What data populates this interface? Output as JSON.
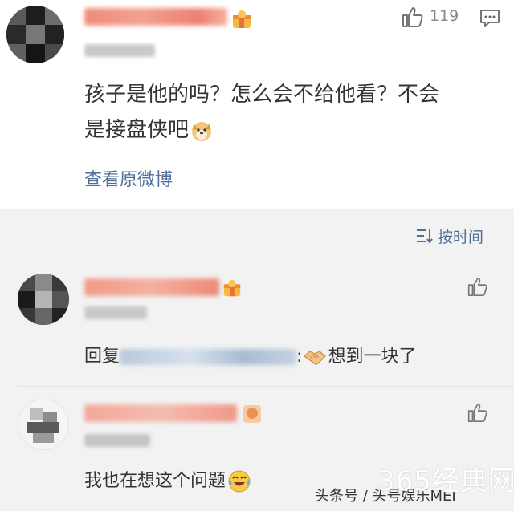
{
  "post": {
    "likes": "119",
    "text_line1": "孩子是他的吗？怎么会不给他看？不会",
    "text_line2": "是接盘侠吧",
    "view_original": "查看原微博"
  },
  "sort_label": "按时间",
  "replies": [
    {
      "prefix": "回复",
      "sep": ":",
      "text": "想到一块了"
    },
    {
      "text": "我也在想这个问题"
    }
  ],
  "watermark": {
    "source": "头条号 / 头号娱乐MEI",
    "site": "365经典网"
  },
  "colors": {
    "link": "#50709b",
    "text": "#333333",
    "background": "#f2f2f2"
  }
}
